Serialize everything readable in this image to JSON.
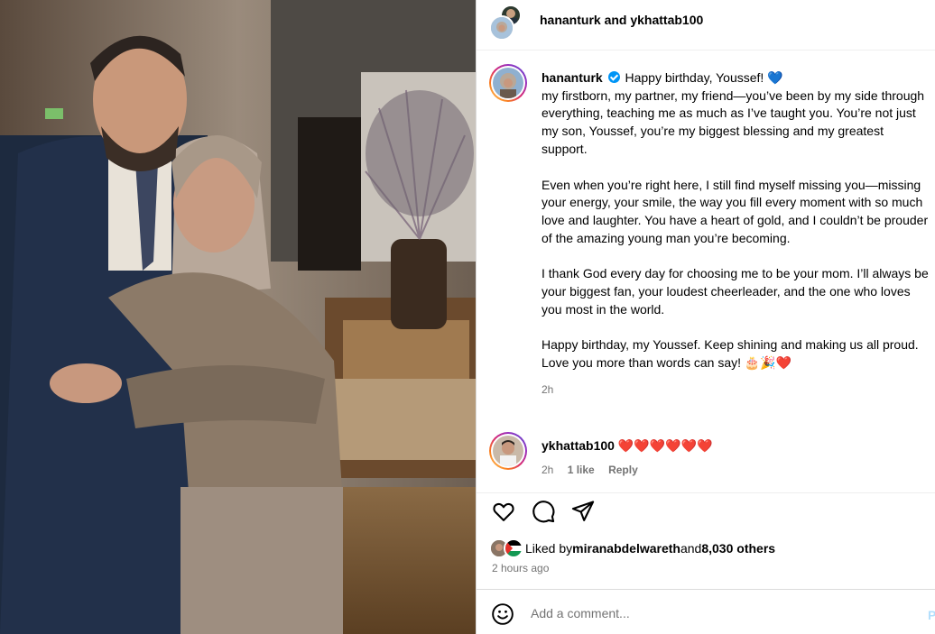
{
  "post_image": {
    "icon": "photo-of-two-people-hugging"
  },
  "header": {
    "title_user1": "hananturk",
    "title_and": " and ",
    "title_user2": "ykhattab100"
  },
  "caption": {
    "username": "hananturk",
    "first_line": "Happy birthday, Youssef! 💙",
    "para1": "my firstborn, my partner, my friend—you’ve been by my side through everything, teaching me as much as I’ve taught you. You’re not just my son, Youssef, you’re my biggest blessing and my greatest support.",
    "para2": "Even when you’re right here, I still find myself missing you—missing your energy, your smile, the way you fill every moment with so much love and laughter. You have a heart of gold, and I couldn’t be prouder of the amazing young man you’re becoming.",
    "para3": "I thank God every day for choosing me to be your mom. I’ll always be your biggest fan, your loudest cheerleader, and the one who loves you most in the world.",
    "para4": "Happy birthday, my Youssef. Keep shining and making us all proud. Love you more than words can say! 🎂🎉❤️",
    "time": "2h"
  },
  "comment": {
    "username": "ykhattab100",
    "text": "❤️❤️❤️❤️❤️❤️",
    "time": "2h",
    "likes": "1 like",
    "reply": "Reply"
  },
  "likes": {
    "prefix": "Liked by ",
    "user": "miranabdelwareth",
    "and": " and ",
    "others": "8,030 others"
  },
  "posted_ago": "2 hours ago",
  "add_comment": {
    "placeholder": "Add a comment...",
    "post_label": "P"
  },
  "colors": {
    "verified": "#0095f6",
    "link_disabled": "#b2dffc",
    "secondary_text": "#737373"
  }
}
